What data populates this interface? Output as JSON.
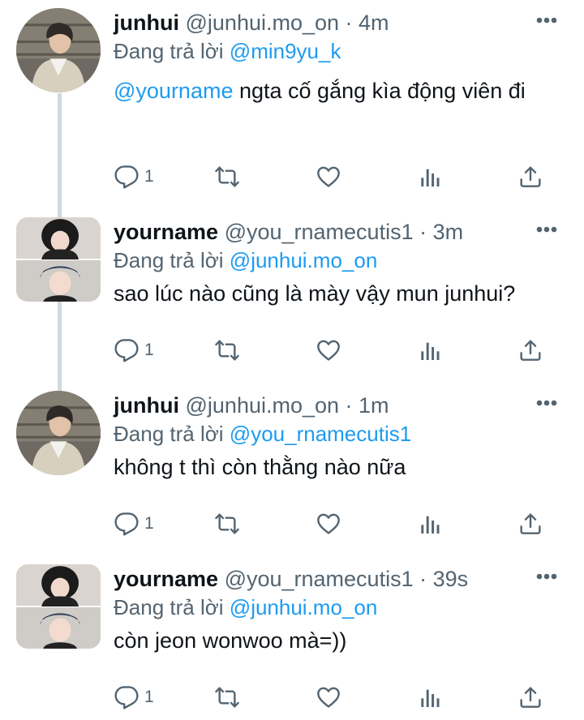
{
  "colors": {
    "accent": "#1d9bf0",
    "muted": "#536471",
    "text": "#0f1419",
    "thread": "#cfd9de"
  },
  "tweets": [
    {
      "name": "junhui",
      "handle": "@junhui.mo_on",
      "time": "· 4m",
      "replying_label": "Đang trả lời",
      "replying_to": "@min9yu_k",
      "mention": "@yourname",
      "body": " ngta cố gắng kìa động viên đi",
      "reply_count": "1",
      "avatar": "junhui-photo"
    },
    {
      "name": "yourname",
      "handle": "@you_rnamecutis1",
      "time": "· 3m",
      "replying_label": "Đang trả lời",
      "replying_to": "@junhui.mo_on",
      "body": "sao lúc nào cũng là mày vậy mun junhui?",
      "reply_count": "1",
      "avatar": "yourname-photo"
    },
    {
      "name": "junhui",
      "handle": "@junhui.mo_on",
      "time": "· 1m",
      "replying_label": "Đang trả lời",
      "replying_to": "@you_rnamecutis1",
      "body": "không t thì còn thằng nào nữa",
      "reply_count": "1",
      "avatar": "junhui-photo"
    },
    {
      "name": "yourname",
      "handle": "@you_rnamecutis1",
      "time": "· 39s",
      "replying_label": "Đang trả lời",
      "replying_to": "@junhui.mo_on",
      "body": "còn jeon wonwoo mà=))",
      "reply_count": "1",
      "avatar": "yourname-photo"
    }
  ],
  "action_icons": [
    "reply-icon",
    "retweet-icon",
    "like-icon",
    "analytics-icon",
    "share-icon"
  ]
}
